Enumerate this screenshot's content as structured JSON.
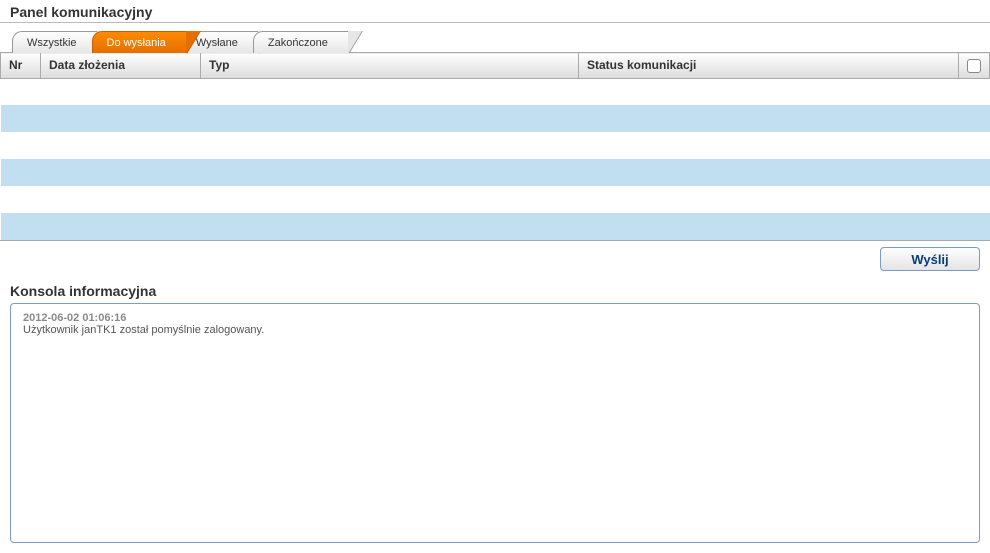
{
  "panel": {
    "title": "Panel komunikacyjny"
  },
  "tabs": [
    {
      "label": "Wszystkie",
      "active": false
    },
    {
      "label": "Do wysłania",
      "active": true
    },
    {
      "label": "Wysłane",
      "active": false
    },
    {
      "label": "Zakończone",
      "active": false
    }
  ],
  "table": {
    "headers": {
      "nr": "Nr",
      "date": "Data złożenia",
      "type": "Typ",
      "status": "Status komunikacji"
    },
    "rows": [
      {
        "nr": "",
        "date": "",
        "type": "",
        "status": ""
      },
      {
        "nr": "",
        "date": "",
        "type": "",
        "status": ""
      },
      {
        "nr": "",
        "date": "",
        "type": "",
        "status": ""
      },
      {
        "nr": "",
        "date": "",
        "type": "",
        "status": ""
      },
      {
        "nr": "",
        "date": "",
        "type": "",
        "status": ""
      },
      {
        "nr": "",
        "date": "",
        "type": "",
        "status": ""
      }
    ]
  },
  "actions": {
    "send": "Wyślij"
  },
  "console": {
    "title": "Konsola informacyjna",
    "entries": [
      {
        "timestamp": "2012-06-02 01:06:16",
        "message": "Użytkownik janTK1 został pomyślnie zalogowany."
      }
    ]
  }
}
